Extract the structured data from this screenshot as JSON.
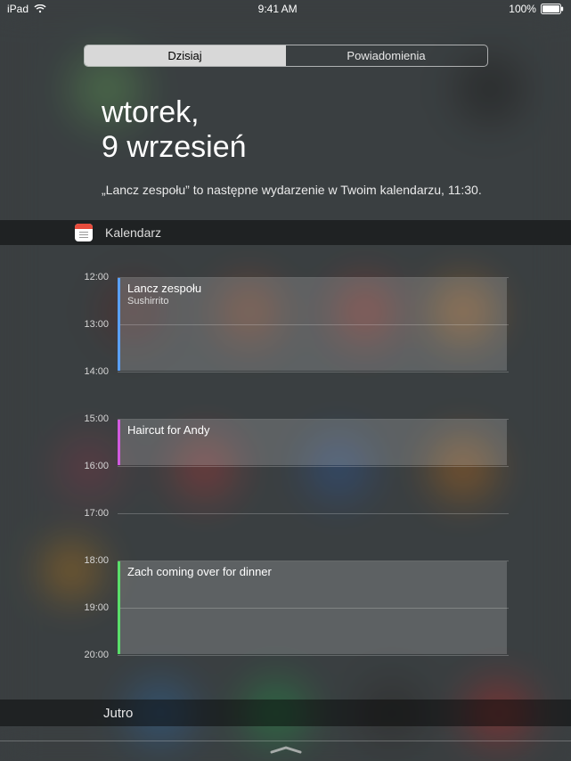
{
  "statusBar": {
    "device": "iPad",
    "time": "9:41 AM",
    "batteryText": "100%"
  },
  "segmented": {
    "today": "Dzisiaj",
    "notifications": "Powiadomienia"
  },
  "date": {
    "line1": "wtorek,",
    "line2": "9 wrzesień"
  },
  "summary": "„Lancz zespołu” to następne wydarzenie w Twoim kalendarzu, 11:30.",
  "calendar": {
    "title": "Kalendarz",
    "hours": [
      "12:00",
      "13:00",
      "14:00",
      "15:00",
      "16:00",
      "17:00",
      "18:00",
      "19:00",
      "20:00"
    ],
    "events": [
      {
        "title": "Lancz zespołu",
        "subtitle": "Sushirrito",
        "color": "#5aa0ff",
        "startHourIndex": 0,
        "durationHours": 2
      },
      {
        "title": "Haircut for Andy",
        "subtitle": "",
        "color": "#d25adf",
        "startHourIndex": 3,
        "durationHours": 1
      },
      {
        "title": "Zach coming over for dinner",
        "subtitle": "",
        "color": "#5adf6a",
        "startHourIndex": 6,
        "durationHours": 2
      }
    ]
  },
  "tomorrowLabel": "Jutro"
}
